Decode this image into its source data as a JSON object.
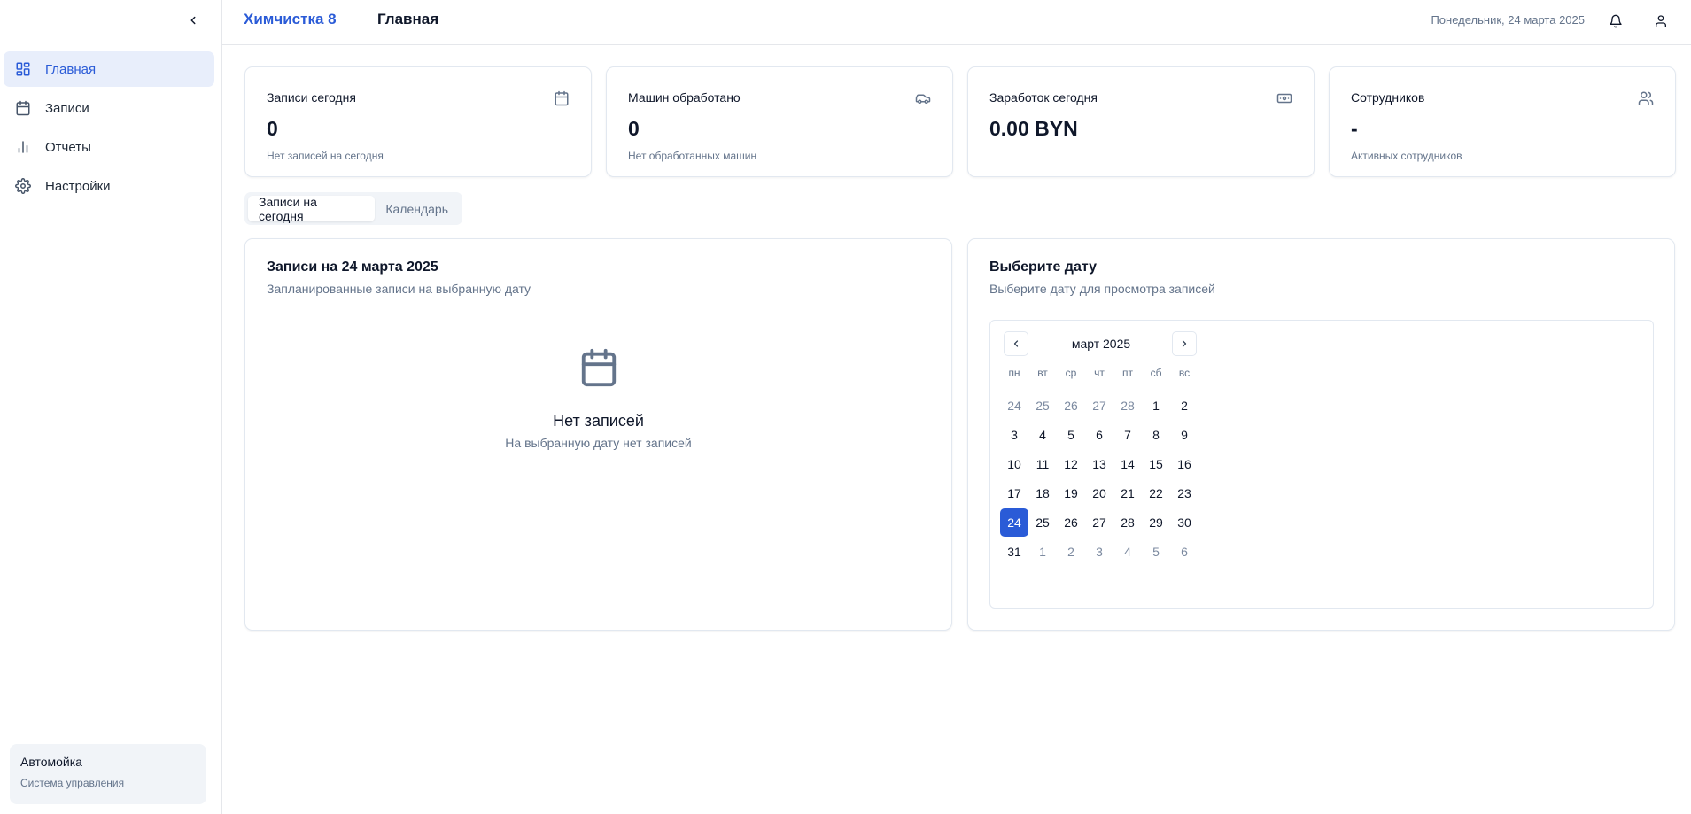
{
  "header": {
    "brand": "Химчистка 8",
    "title": "Главная",
    "date": "Понедельник, 24 марта 2025"
  },
  "sidebar": {
    "items": [
      {
        "label": "Главная",
        "icon": "dashboard-icon",
        "active": true
      },
      {
        "label": "Записи",
        "icon": "calendar-icon",
        "active": false
      },
      {
        "label": "Отчеты",
        "icon": "bar-chart-icon",
        "active": false
      },
      {
        "label": "Настройки",
        "icon": "gear-icon",
        "active": false
      }
    ],
    "org": {
      "name": "Автомойка",
      "subtitle": "Система управления"
    }
  },
  "stats": [
    {
      "title": "Записи сегодня",
      "value": "0",
      "sub": "Нет записей на сегодня",
      "icon": "calendar-icon"
    },
    {
      "title": "Машин обработано",
      "value": "0",
      "sub": "Нет обработанных машин",
      "icon": "car-icon"
    },
    {
      "title": "Заработок сегодня",
      "value": "0.00 BYN",
      "sub": "",
      "icon": "banknote-icon"
    },
    {
      "title": "Сотрудников",
      "value": "-",
      "sub": "Активных сотрудников",
      "icon": "users-icon"
    }
  ],
  "tabs": [
    {
      "label": "Записи на сегодня",
      "active": true
    },
    {
      "label": "Календарь",
      "active": false
    }
  ],
  "appointments": {
    "title": "Записи на 24 марта 2025",
    "subtitle": "Запланированные записи на выбранную дату",
    "empty_title": "Нет записей",
    "empty_sub": "На выбранную дату нет записей"
  },
  "datepicker": {
    "title": "Выберите дату",
    "subtitle": "Выберите дату для просмотра записей",
    "month": "март 2025",
    "weekdays": [
      "пн",
      "вт",
      "ср",
      "чт",
      "пт",
      "сб",
      "вс"
    ],
    "weeks": [
      [
        [
          "24",
          1
        ],
        [
          "25",
          1
        ],
        [
          "26",
          1
        ],
        [
          "27",
          1
        ],
        [
          "28",
          1
        ],
        [
          "1",
          0
        ],
        [
          "2",
          0
        ]
      ],
      [
        [
          "3",
          0
        ],
        [
          "4",
          0
        ],
        [
          "5",
          0
        ],
        [
          "6",
          0
        ],
        [
          "7",
          0
        ],
        [
          "8",
          0
        ],
        [
          "9",
          0
        ]
      ],
      [
        [
          "10",
          0
        ],
        [
          "11",
          0
        ],
        [
          "12",
          0
        ],
        [
          "13",
          0
        ],
        [
          "14",
          0
        ],
        [
          "15",
          0
        ],
        [
          "16",
          0
        ]
      ],
      [
        [
          "17",
          0
        ],
        [
          "18",
          0
        ],
        [
          "19",
          0
        ],
        [
          "20",
          0
        ],
        [
          "21",
          0
        ],
        [
          "22",
          0
        ],
        [
          "23",
          0
        ]
      ],
      [
        [
          "24",
          2
        ],
        [
          "25",
          0
        ],
        [
          "26",
          0
        ],
        [
          "27",
          0
        ],
        [
          "28",
          0
        ],
        [
          "29",
          0
        ],
        [
          "30",
          0
        ]
      ],
      [
        [
          "31",
          0
        ],
        [
          "1",
          1
        ],
        [
          "2",
          1
        ],
        [
          "3",
          1
        ],
        [
          "4",
          1
        ],
        [
          "5",
          1
        ],
        [
          "6",
          1
        ]
      ]
    ],
    "selected": "24"
  },
  "colors": {
    "accent": "#2a5bd7",
    "muted": "#64748b",
    "active_bg": "#e8eefb"
  }
}
